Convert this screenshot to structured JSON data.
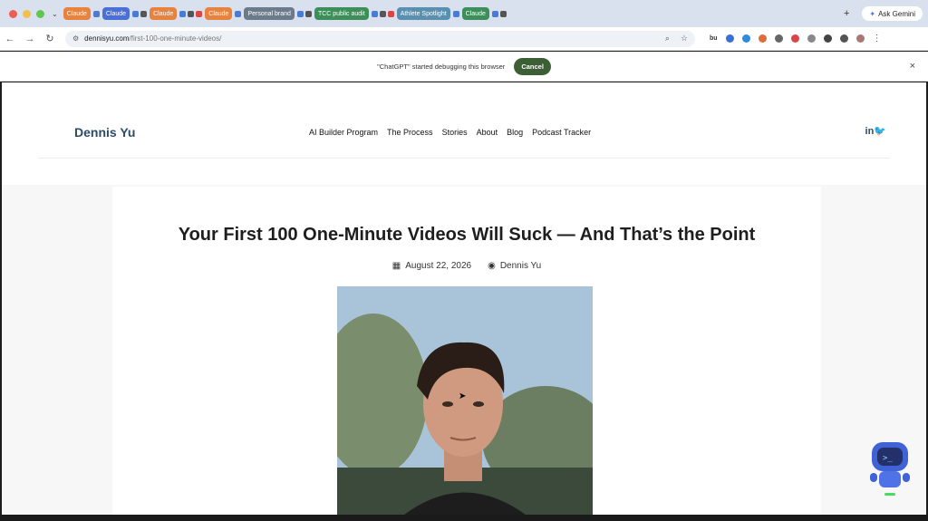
{
  "browser": {
    "tabs": [
      {
        "label": "Claude",
        "color": "#e8823f"
      },
      {
        "label": "Claude",
        "color": "#4a6fd6"
      },
      {
        "label": "Claude",
        "color": "#e8823f"
      },
      {
        "label": "Claude",
        "color": "#e8823f"
      },
      {
        "label": "Personal brand",
        "color": "#6b7b8c"
      },
      {
        "label": "TCC public audit",
        "color": "#3d8f5a"
      },
      {
        "label": "Athlete Spotlight",
        "color": "#5a8fb0"
      },
      {
        "label": "Claude",
        "color": "#3d8f5a"
      }
    ],
    "new_tab_label": "+",
    "ask_gemini_label": "Ask Gemini",
    "url_host": "dennisyu.com",
    "url_path": "/first-100-one-minute-videos/",
    "extension_text": "bu"
  },
  "debug_banner": {
    "message": "\"ChatGPT\" started debugging this browser",
    "cancel_label": "Cancel",
    "close_label": "×"
  },
  "site": {
    "logo": "Dennis Yu",
    "nav": [
      "AI Builder Program",
      "The Process",
      "Stories",
      "About",
      "Blog",
      "Podcast Tracker"
    ],
    "social": "in"
  },
  "article": {
    "title": "Your First 100 One-Minute Videos Will Suck — And That’s the Point",
    "date": "August 22, 2026",
    "author": "Dennis Yu"
  },
  "colors": {
    "accent": "#3d5f36",
    "brand": "#2d4b66"
  }
}
